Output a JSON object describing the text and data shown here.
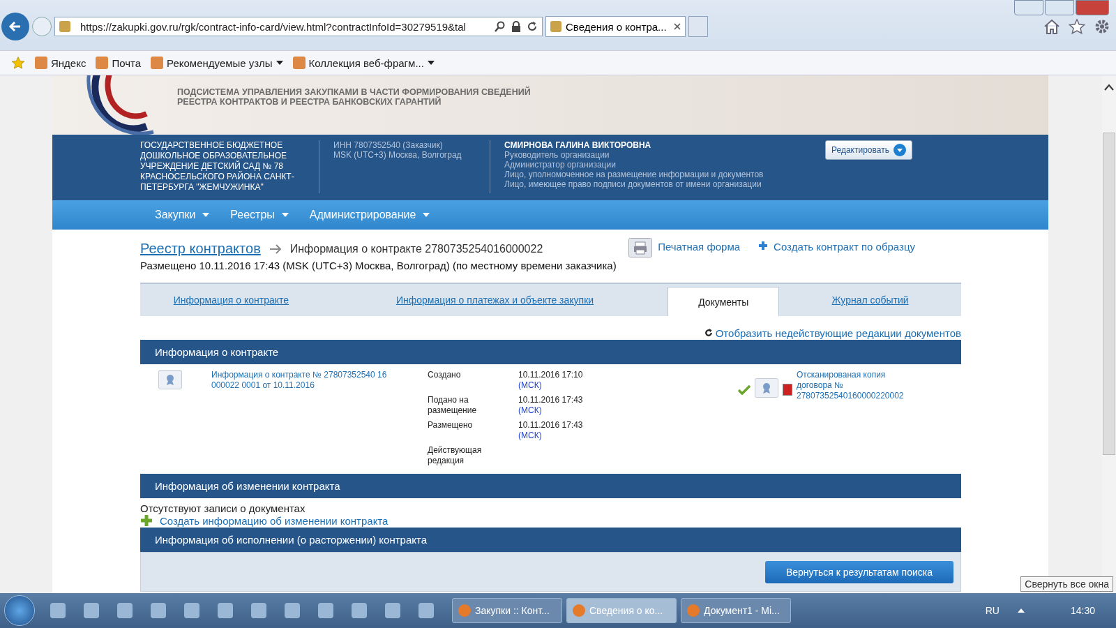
{
  "browser": {
    "address": "https://zakupki.gov.ru/rgk/contract-info-card/view.html?contractInfoId=30279519&tal",
    "tabs": [
      {
        "title": "Сведения о контра...",
        "selected": true
      }
    ],
    "favorites": [
      {
        "label": "Яндекс",
        "dropdown": false
      },
      {
        "label": "Почта",
        "dropdown": false
      },
      {
        "label": "Рекомендуемые узлы",
        "dropdown": true
      },
      {
        "label": "Коллекция веб-фрагм...",
        "dropdown": true
      }
    ]
  },
  "header": {
    "subtitle": [
      "ПОДСИСТЕМА УПРАВЛЕНИЯ ЗАКУПКАМИ В ЧАСТИ ФОРМИРОВАНИЯ СВЕДЕНИЙ",
      "РЕЕСТРА КОНТРАКТОВ И РЕЕСТРА БАНКОВСКИХ ГАРАНТИЙ"
    ]
  },
  "org": {
    "name": "ГОСУДАРСТВЕННОЕ БЮДЖЕТНОЕ ДОШКОЛЬНОЕ ОБРАЗОВАТЕЛЬНОЕ УЧРЕЖДЕНИЕ ДЕТСКИЙ САД № 78 КРАСНОСЕЛЬСКОГО РАЙОНА САНКТ-ПЕТЕРБУРГА \"ЖЕМЧУЖИНКА\"",
    "details": [
      "ИНН 7807352540 (Заказчик)",
      "MSK (UTC+3) Москва, Волгоград"
    ],
    "user": "СМИРНОВА ГАЛИНА ВИКТОРОВНА",
    "roles": [
      "Руководитель организации",
      "Администратор организации",
      "Лицо, уполномоченное на размещение информации и документов",
      "Лицо, имеющее право подписи документов от имени организации"
    ],
    "edit_button": "Редактировать"
  },
  "nav": [
    "Закупки",
    "Реестры",
    "Администрирование"
  ],
  "breadcrumb": {
    "link": "Реестр контрактов",
    "current": "Информация о контракте 2780735254016000022",
    "placed": "Размещено 10.11.2016 17:43 (MSK (UTC+3) Москва, Волгоград) (по местному времени заказчика)"
  },
  "actions": [
    {
      "label": "Печатная форма",
      "kind": "print"
    },
    {
      "label": "Создать контракт по образцу",
      "kind": "add"
    }
  ],
  "tabs": [
    {
      "label": "Информация о контракте",
      "selected": false
    },
    {
      "label": "Информация о платежах и объекте закупки",
      "selected": false
    },
    {
      "label": "Документы",
      "selected": true
    },
    {
      "label": "Журнал событий",
      "selected": false
    }
  ],
  "show_inactive": "Отобразить недействующие редакции документов",
  "contract_section": {
    "title": "Информация о контракте",
    "document": "Информация о контракте № 27807352540 16 000022 0001 от 10.11.2016",
    "dates": [
      {
        "label": "Создано",
        "value": "10.11.2016 17:10",
        "tz": "(МСК)"
      },
      {
        "label": "Подано на размещение",
        "value": "10.11.2016 17:43",
        "tz": "(МСК)"
      },
      {
        "label": "Размещено",
        "value": "10.11.2016 17:43",
        "tz": "(МСК)"
      },
      {
        "label": "Действующая редакция"
      }
    ],
    "signed": true,
    "scan": "Отсканированая копия договора № 27807352540160000220002"
  },
  "change_section": {
    "title": "Информация об изменении контракта",
    "empty": "Отсутствуют записи о документах",
    "create": "Создать информацию об изменении контракта"
  },
  "execution_section": {
    "title": "Информация об исполнении (о расторжении) контракта"
  },
  "back_button": "Вернуться к результатам поиска",
  "taskbar": {
    "windows": [
      {
        "label": "Закупки :: Конт...",
        "selected": false
      },
      {
        "label": "Сведения о ко...",
        "selected": true
      },
      {
        "label": "Документ1 - Mi...",
        "selected": false
      }
    ],
    "lang": "RU",
    "time": "14:30",
    "tooltip": "Свернуть все окна"
  }
}
